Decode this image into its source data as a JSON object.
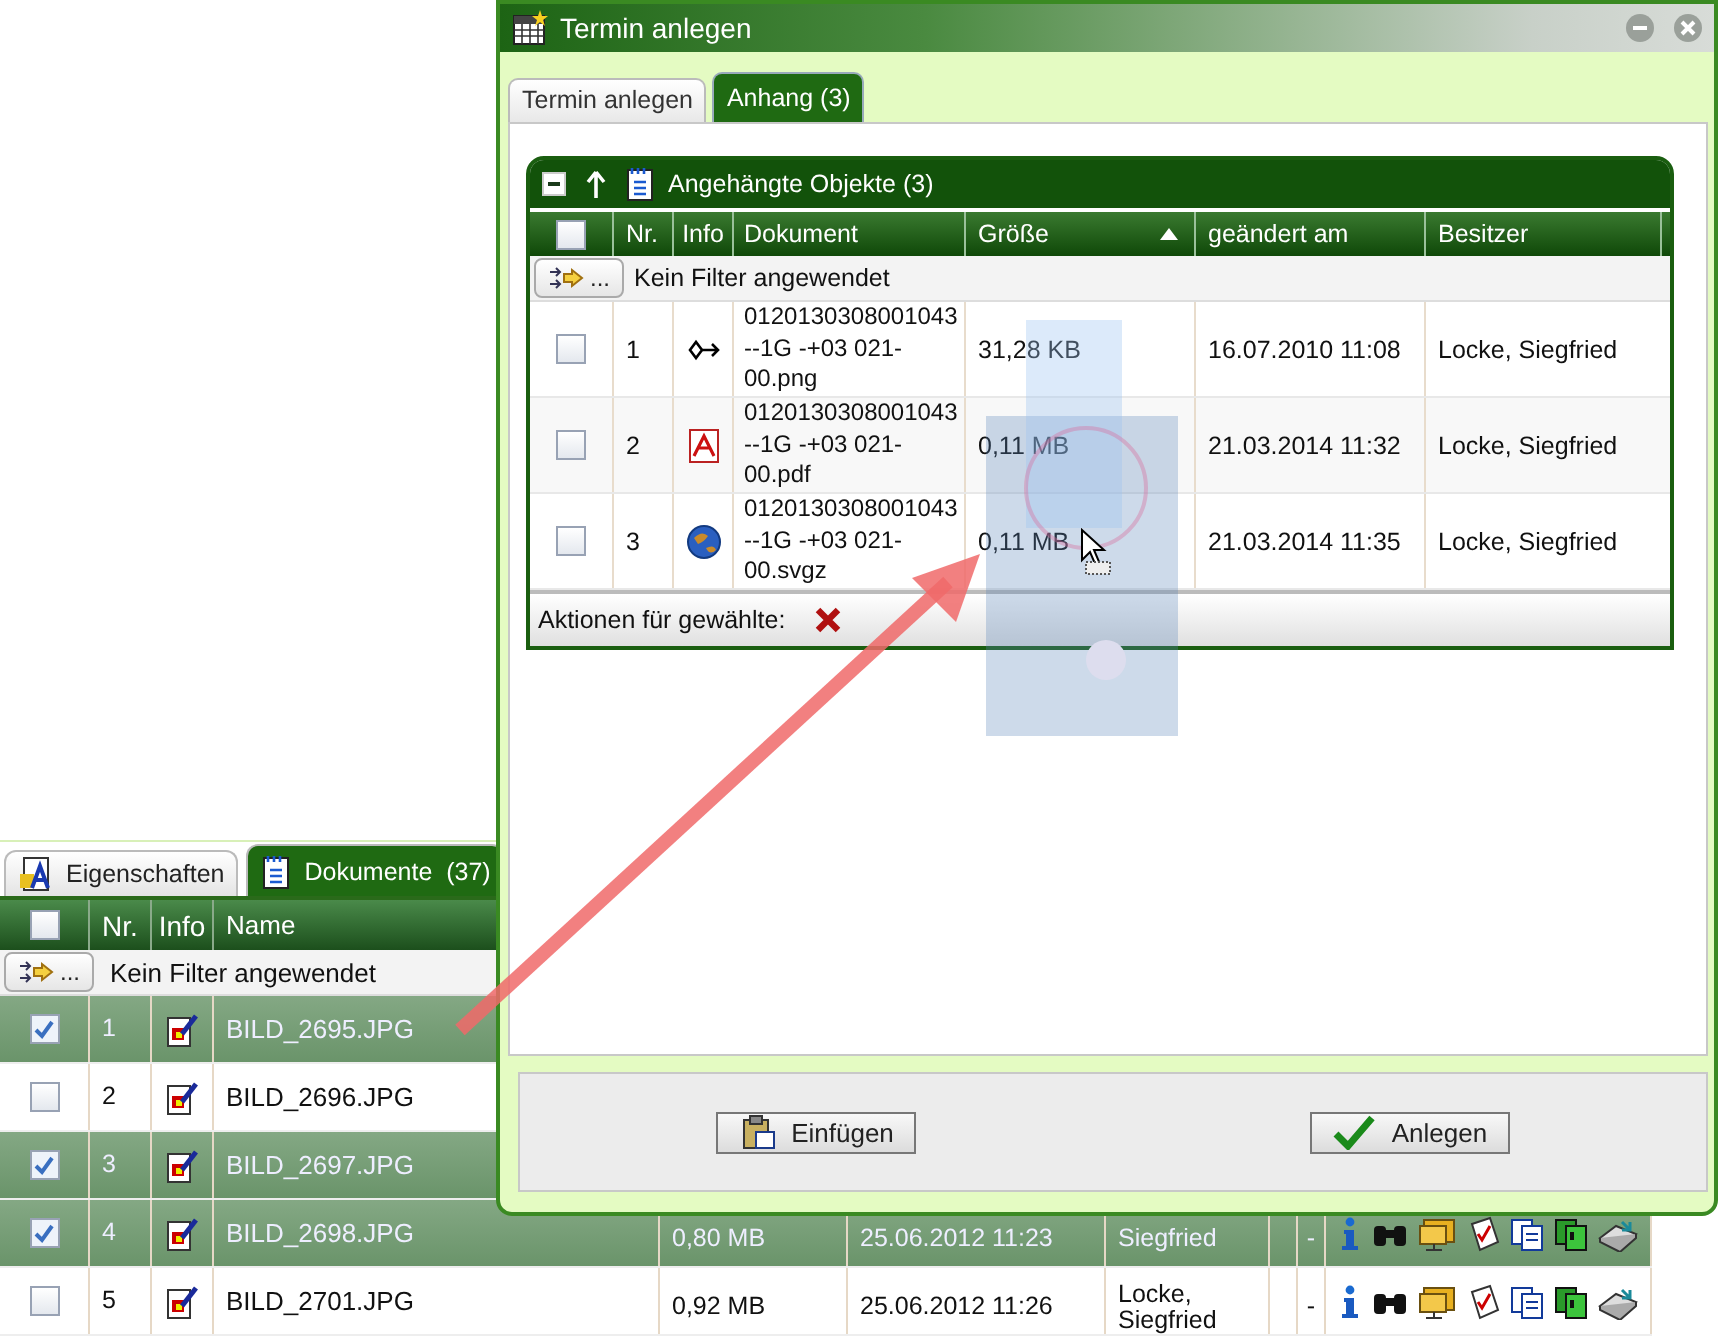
{
  "documents_panel": {
    "tabs": [
      {
        "label": "Eigenschaften",
        "selected": false,
        "kind": "properties"
      },
      {
        "label": "Dokumente  (37)",
        "selected": true,
        "kind": "documents"
      }
    ],
    "select_all_checked": false,
    "columns": [
      "Nr.",
      "Info",
      "Name"
    ],
    "filter": {
      "button": "...",
      "text": "Kein Filter angewendet"
    },
    "rows": [
      {
        "checked": true,
        "selected": true,
        "nr": "1",
        "name": "BILD_2695.JPG"
      },
      {
        "checked": false,
        "selected": false,
        "nr": "2",
        "name": "BILD_2696.JPG"
      },
      {
        "checked": true,
        "selected": true,
        "nr": "3",
        "name": "BILD_2697.JPG"
      },
      {
        "checked": true,
        "selected": true,
        "nr": "4",
        "name": "BILD_2698.JPG",
        "column_5": "0,80 MB",
        "column_6": "25.06.2012 11:23",
        "column_7": "Siegfried",
        "column_9": "-"
      },
      {
        "checked": false,
        "selected": false,
        "nr": "5",
        "name": "BILD_2701.JPG",
        "column_5": "0,92 MB",
        "column_6": "25.06.2012 11:26",
        "column_7": "Locke, Siegfried",
        "column_9": "-"
      }
    ]
  },
  "dialog": {
    "title": "Termin anlegen",
    "tabs": [
      {
        "label": "Termin anlegen",
        "selected": false
      },
      {
        "label": "Anhang (3)",
        "selected": true
      }
    ],
    "attachments": {
      "title": "Angehängte Objekte (3)",
      "select_all_checked": false,
      "columns": [
        {
          "label": "Nr.",
          "sorted": false
        },
        {
          "label": "Info",
          "sorted": false
        },
        {
          "label": "Dokument",
          "sorted": false
        },
        {
          "label": "Größe",
          "sorted": true
        },
        {
          "label": "geändert am",
          "sorted": false
        },
        {
          "label": "Besitzer",
          "sorted": false
        }
      ],
      "filter": {
        "button": "...",
        "text": "Kein Filter angewendet"
      },
      "rows": [
        {
          "checked": false,
          "nr": "1",
          "kind": "link",
          "document": "0120130308001043--1G -+03 021-00.png",
          "size": "31,28 KB",
          "changed": "16.07.2010 11:08",
          "owner": "Locke, Siegfried"
        },
        {
          "checked": false,
          "nr": "2",
          "kind": "pdf",
          "document": "0120130308001043--1G -+03 021-00.pdf",
          "size": "0,11 MB",
          "changed": "21.03.2014 11:32",
          "owner": "Locke, Siegfried"
        },
        {
          "checked": false,
          "nr": "3",
          "kind": "globe",
          "document": "0120130308001043--1G -+03 021-00.svgz",
          "size": "0,11 MB",
          "changed": "21.03.2014 11:35",
          "owner": "Locke, Siegfried"
        }
      ],
      "actions_label": "Aktionen für gewählte:"
    },
    "buttons": [
      {
        "label": "Einfügen",
        "kind": "paste"
      },
      {
        "label": "Anlegen",
        "kind": "confirm"
      }
    ]
  }
}
